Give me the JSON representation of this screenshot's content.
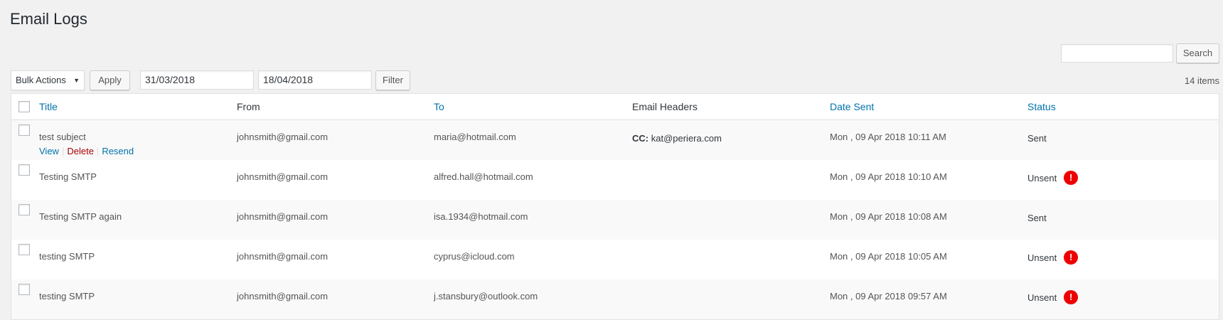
{
  "page": {
    "title": "Email Logs"
  },
  "search": {
    "button_label": "Search",
    "value": ""
  },
  "toolbar": {
    "bulk_actions": "Bulk Actions",
    "apply_label": "Apply",
    "date_from": "31/03/2018",
    "date_to": "18/04/2018",
    "filter_label": "Filter",
    "items_count": "14 items"
  },
  "table": {
    "headers": {
      "title": "Title",
      "from": "From",
      "to": "To",
      "email_headers": "Email Headers",
      "date_sent": "Date Sent",
      "status": "Status"
    },
    "row_actions": {
      "view": "View",
      "delete": "Delete",
      "resend": "Resend"
    },
    "rows": [
      {
        "title": "test subject",
        "from": "johnsmith@gmail.com",
        "to": "maria@hotmail.com",
        "cc_label": "CC:",
        "cc_value": "kat@periera.com",
        "date": "Mon , 09 Apr 2018 10:11 AM",
        "status": "Sent"
      },
      {
        "title": "Testing SMTP",
        "from": "johnsmith@gmail.com",
        "to": "alfred.hall@hotmail.com",
        "date": "Mon , 09 Apr 2018 10:10 AM",
        "status": "Unsent"
      },
      {
        "title": "Testing SMTP again",
        "from": "johnsmith@gmail.com",
        "to": "isa.1934@hotmail.com",
        "date": "Mon , 09 Apr 2018 10:08 AM",
        "status": "Sent"
      },
      {
        "title": "testing SMTP",
        "from": "johnsmith@gmail.com",
        "to": "cyprus@icloud.com",
        "date": "Mon , 09 Apr 2018 10:05 AM",
        "status": "Unsent"
      },
      {
        "title": "testing SMTP",
        "from": "johnsmith@gmail.com",
        "to": "j.stansbury@outlook.com",
        "date": "Mon , 09 Apr 2018 09:57 AM",
        "status": "Unsent"
      }
    ]
  },
  "icons": {
    "alert": "!"
  },
  "colors": {
    "link": "#0073aa",
    "delete": "#aa0000",
    "alert": "#ee0000"
  }
}
